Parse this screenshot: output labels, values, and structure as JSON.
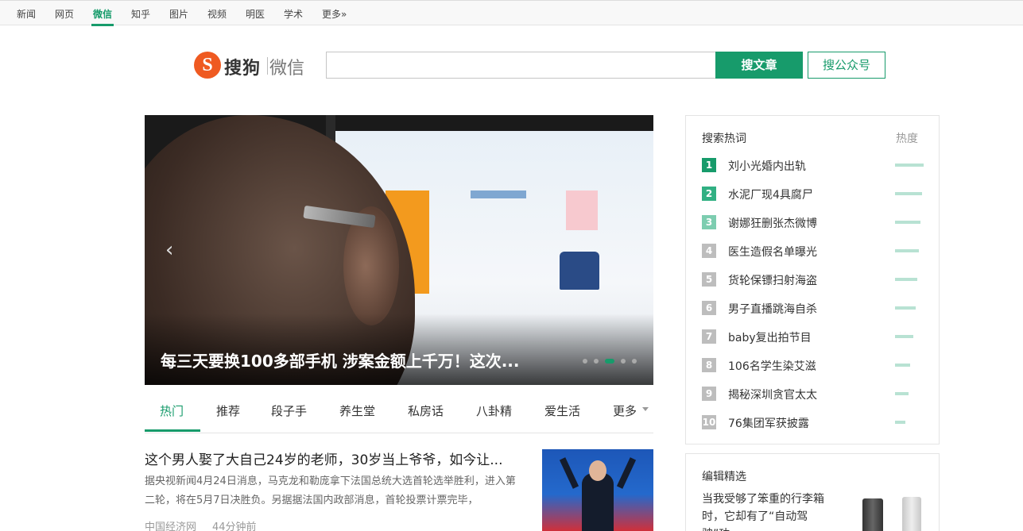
{
  "topnav": {
    "items": [
      {
        "label": "新闻"
      },
      {
        "label": "网页"
      },
      {
        "label": "微信"
      },
      {
        "label": "知乎"
      },
      {
        "label": "图片"
      },
      {
        "label": "视频"
      },
      {
        "label": "明医"
      },
      {
        "label": "学术"
      },
      {
        "label": "更多»"
      }
    ],
    "active": "微信"
  },
  "header": {
    "logo_letter": "S",
    "logo_brand": "搜狗",
    "logo_product": "微信",
    "search_value": "",
    "search_article_button": "搜文章",
    "search_account_button": "搜公众号"
  },
  "banner": {
    "caption": "每三天要换100多部手机 涉案金额上千万！这次...",
    "prev_arrow": "‹",
    "slide_count": 5,
    "active_slide": 3
  },
  "tabs": [
    {
      "label": "热门"
    },
    {
      "label": "推荐"
    },
    {
      "label": "段子手"
    },
    {
      "label": "养生堂"
    },
    {
      "label": "私房话"
    },
    {
      "label": "八卦精"
    },
    {
      "label": "爱生活"
    },
    {
      "label": "更多"
    }
  ],
  "article": {
    "title": "这个男人娶了大自己24岁的老师，30岁当上爷爷，如今让...",
    "summary": "据央视新闻4月24日消息，马克龙和勒庞拿下法国总统大选首轮选举胜利，进入第二轮，将在5月7日决胜负。另据据法国内政部消息，首轮投票计票完毕，",
    "source": "中国经济网",
    "time": "44分钟前"
  },
  "hot_search": {
    "title": "搜索热词",
    "heat_label": "热度",
    "items": [
      {
        "rank": "1",
        "word": "刘小光婚内出轨",
        "heat": 1.0,
        "color": "#179b6b"
      },
      {
        "rank": "2",
        "word": "水泥厂现4具腐尸",
        "heat": 0.94,
        "color": "#31b083"
      },
      {
        "rank": "3",
        "word": "谢娜狂删张杰微博",
        "heat": 0.89,
        "color": "#7dcdb0"
      },
      {
        "rank": "4",
        "word": "医生造假名单曝光",
        "heat": 0.83,
        "color": "#bdbdbd"
      },
      {
        "rank": "5",
        "word": "货轮保镖扫射海盗",
        "heat": 0.77,
        "color": "#bdbdbd"
      },
      {
        "rank": "6",
        "word": "男子直播跳海自杀",
        "heat": 0.71,
        "color": "#bdbdbd"
      },
      {
        "rank": "7",
        "word": "baby复出拍节目",
        "heat": 0.63,
        "color": "#bdbdbd"
      },
      {
        "rank": "8",
        "word": "106名学生染艾滋",
        "heat": 0.54,
        "color": "#bdbdbd"
      },
      {
        "rank": "9",
        "word": "揭秘深圳贪官太太",
        "heat": 0.46,
        "color": "#bdbdbd"
      },
      {
        "rank": "10",
        "word": "76集团军获披露",
        "heat": 0.37,
        "color": "#bdbdbd"
      }
    ]
  },
  "editor_picks": {
    "title": "编辑精选",
    "headline": "当我受够了笨重的行李箱时，它却有了“自动驾驶”功..."
  },
  "colors": {
    "accent": "#179b6b",
    "logo_orange": "#ef5a21"
  }
}
